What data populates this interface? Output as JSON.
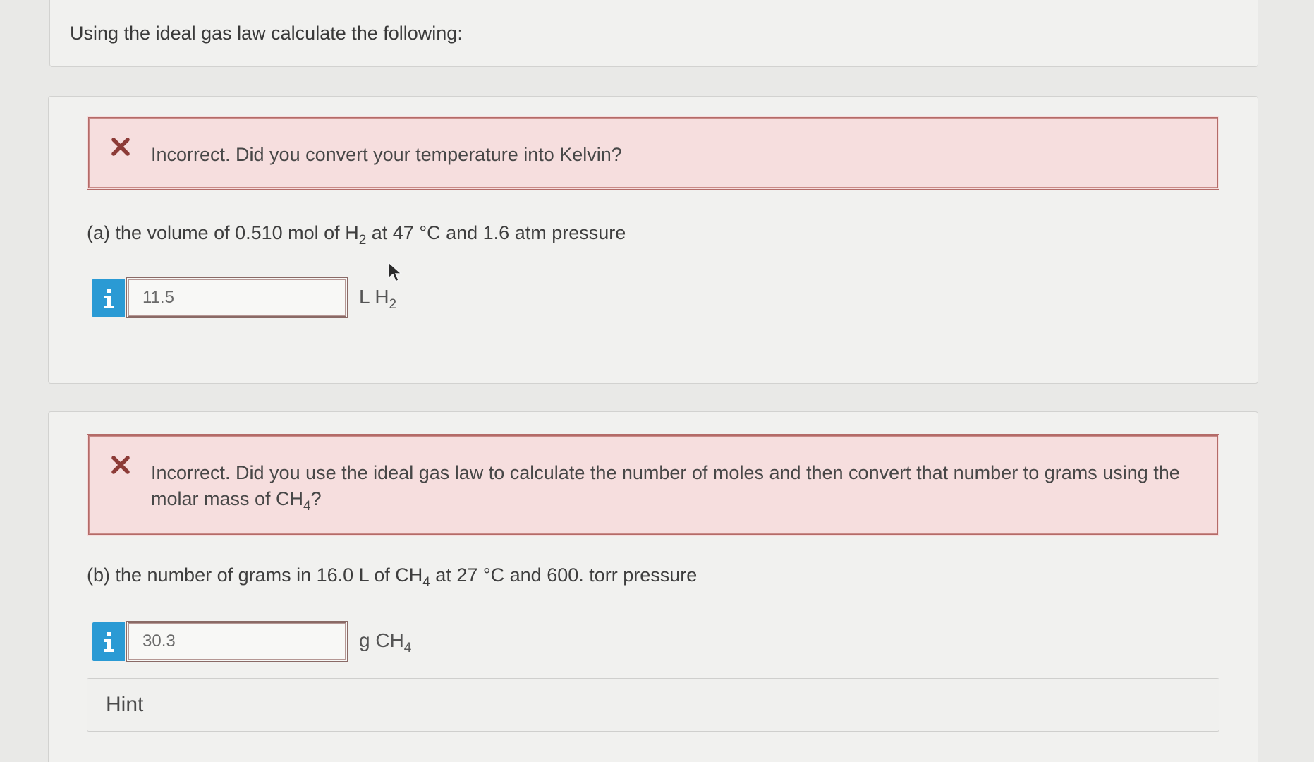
{
  "intro": {
    "text": "Using the ideal gas law calculate the following:"
  },
  "part_a": {
    "feedback": "Incorrect. Did you convert your temperature into Kelvin?",
    "question": {
      "pre": "(a) the volume of 0.510 mol of H",
      "sub": "2",
      "post": " at 47 °C and 1.6 atm pressure"
    },
    "answer_value": "11.5",
    "unit": {
      "main": "L H",
      "sub": "2"
    }
  },
  "part_b": {
    "feedback": {
      "pre": "Incorrect. Did you use the ideal gas law to calculate the number of moles and then convert that number to grams using the molar mass of CH",
      "sub": "4",
      "post": "?"
    },
    "question": {
      "pre": "(b) the number of grams in 16.0 L of CH",
      "sub": "4",
      "post": " at 27 °C and 600. torr pressure"
    },
    "answer_value": "30.3",
    "unit": {
      "main": "g CH",
      "sub": "4"
    }
  },
  "hint": {
    "label": "Hint"
  },
  "icons": {
    "incorrect": "x-mark-icon",
    "info": "info-icon",
    "cursor": "mouse-pointer-icon"
  },
  "colors": {
    "feedback_bg": "#f6dede",
    "feedback_border": "#b46b68",
    "x_mark": "#8c3b37",
    "info_blue": "#2a9ad4"
  }
}
